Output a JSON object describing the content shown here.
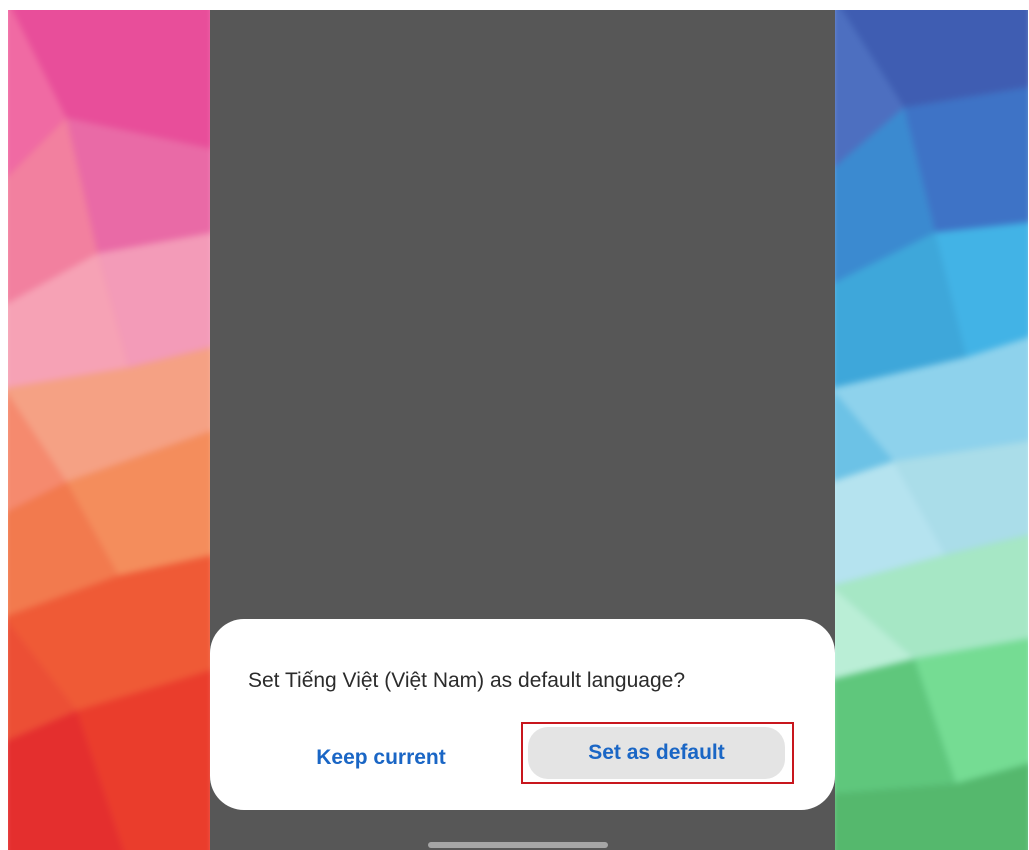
{
  "dialog": {
    "message": "Set Tiếng Việt (Việt Nam) as default language?",
    "keep_label": "Keep current",
    "default_label": "Set as default"
  },
  "colors": {
    "accent": "#1a66c5",
    "highlight_outline": "#c8161d",
    "screen_background": "#575757",
    "dialog_background": "#ffffff"
  }
}
